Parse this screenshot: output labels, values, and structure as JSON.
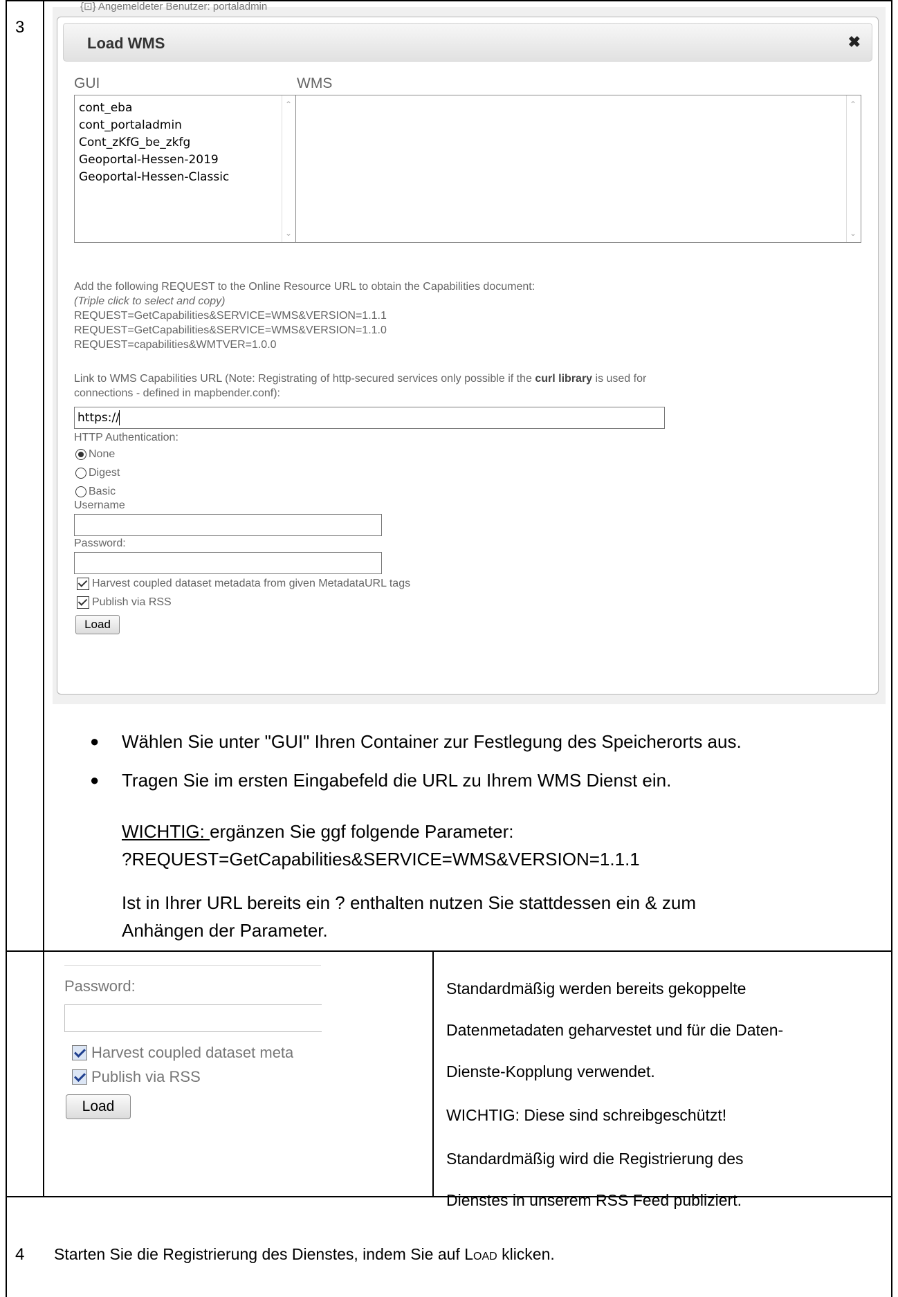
{
  "step3": {
    "number": "3",
    "background_text": "{⊡} Angemeldeter Benutzer: portaladmin",
    "dialog": {
      "title": "Load WMS",
      "close_icon": "close-icon",
      "gui_header": "GUI",
      "wms_header": "WMS",
      "gui_items": [
        "cont_eba",
        "cont_portaladmin",
        "Cont_zKfG_be_zkfg",
        "Geoportal-Hessen-2019",
        "Geoportal-Hessen-Classic"
      ],
      "request_intro": "Add the following REQUEST to the Online Resource URL to obtain the Capabilities document:",
      "request_hint": "(Triple click to select and copy)",
      "request_lines": [
        "REQUEST=GetCapabilities&SERVICE=WMS&VERSION=1.1.1",
        "REQUEST=GetCapabilities&SERVICE=WMS&VERSION=1.1.0",
        "REQUEST=capabilities&WMTVER=1.0.0"
      ],
      "link_note_pre": "Link to WMS Capabilities URL (Note: Registrating of http-secured services only possible if the ",
      "link_note_bold": "curl library",
      "link_note_post": " is used for",
      "link_note_line2": "connections - defined in mapbender.conf):",
      "url_value": "https://",
      "auth_label": "HTTP Authentication:",
      "auth_options": [
        "None",
        "Digest",
        "Basic"
      ],
      "auth_selected": "None",
      "username_label": "Username",
      "password_label": "Password:",
      "harvest_label": "Harvest coupled dataset metadata from given MetadataURL tags",
      "rss_label": "Publish via RSS",
      "load_button": "Load"
    },
    "bullets": [
      "Wählen Sie unter \"GUI\" Ihren Container zur Festlegung des Speicherorts aus.",
      "Tragen Sie im ersten Eingabefeld die URL zu Ihrem WMS Dienst ein."
    ],
    "important_label": "WICHTIG: ",
    "important_text": "ergänzen Sie ggf folgende Parameter:",
    "param_line": "?REQUEST=GetCapabilities&SERVICE=WMS&VERSION=1.1.1",
    "url_note_line1": "Ist in Ihrer URL bereits ein ? enthalten nutzen Sie stattdessen ein & zum",
    "url_note_line2": "Anhängen der Parameter."
  },
  "detail": {
    "crop": {
      "password_label": "Password:",
      "harvest_label": "Harvest coupled dataset meta",
      "rss_label": "Publish via RSS",
      "load_button": "Load"
    },
    "text_lines": [
      "Standardmäßig werden bereits gekoppelte",
      "Datenmetadaten geharvestet und für die Daten-",
      "Dienste-Kopplung verwendet.",
      "WICHTIG: Diese sind schreibgeschützt!",
      "Standardmäßig wird die Registrierung des",
      "Dienstes in unserem RSS Feed publiziert."
    ]
  },
  "step4": {
    "number": "4",
    "text_pre": "Starten Sie die Registrierung des Dienstes, indem Sie auf ",
    "text_load": "Load",
    "text_post": " klicken."
  }
}
